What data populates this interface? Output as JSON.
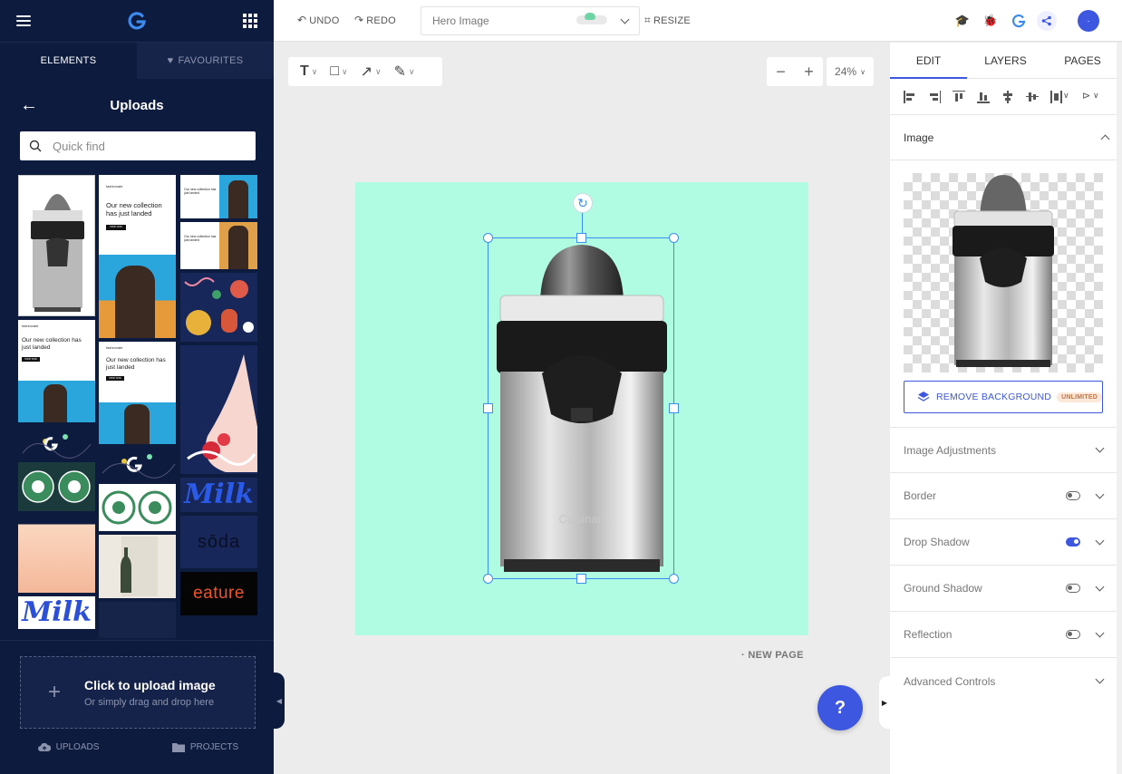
{
  "sidebar": {
    "tabs": [
      {
        "label": "ELEMENTS",
        "active": true
      },
      {
        "label": "FAVOURITES",
        "active": false
      }
    ],
    "title": "Uploads",
    "search_placeholder": "Quick find",
    "thumbs": {
      "newsletter_brand": "fashionate",
      "newsletter_headline": "Our new collection has just landed",
      "newsletter_button": "SHOP NOW",
      "logo_milk": "Milk",
      "logo_soda": "sōda",
      "logo_eature": "eature"
    },
    "upload": {
      "title": "Click to upload image",
      "subtitle": "Or simply drag and drop here",
      "plus": "+"
    },
    "footer": [
      {
        "label": "UPLOADS",
        "icon": "cloud-upload-icon"
      },
      {
        "label": "PROJECTS",
        "icon": "folder-icon"
      }
    ]
  },
  "topbar": {
    "undo": "UNDO",
    "redo": "REDO",
    "doc_name": "Hero Image",
    "resize": "RESIZE",
    "avatar_initial": "·"
  },
  "canvas": {
    "tools": [
      {
        "name": "text-tool",
        "glyph": "T"
      },
      {
        "name": "shape-tool",
        "glyph": "□"
      },
      {
        "name": "arrow-tool",
        "glyph": "↗"
      },
      {
        "name": "pen-tool",
        "glyph": "✎"
      }
    ],
    "zoom_out": "−",
    "zoom_in": "+",
    "zoom": "24%",
    "new_page": "· NEW PAGE",
    "help": "?",
    "artboard_color": "#b0fce2",
    "product_brand": "Cuisinart"
  },
  "right_panel": {
    "tabs": [
      {
        "label": "EDIT",
        "active": true
      },
      {
        "label": "LAYERS",
        "active": false
      },
      {
        "label": "PAGES",
        "active": false
      }
    ],
    "image_section": "Image",
    "remove_bg": "REMOVE BACKGROUND",
    "remove_bg_badge": "UNLIMITED",
    "sections": [
      {
        "label": "Image Adjustments",
        "toggle": null
      },
      {
        "label": "Border",
        "toggle": "off"
      },
      {
        "label": "Drop Shadow",
        "toggle": "on"
      },
      {
        "label": "Ground Shadow",
        "toggle": "off"
      },
      {
        "label": "Reflection",
        "toggle": "off"
      },
      {
        "label": "Advanced Controls",
        "toggle": null
      }
    ]
  },
  "colors": {
    "accent": "#3d57e0",
    "sidebar_bg": "#0d1b3e",
    "selection": "#3a8ef0"
  }
}
